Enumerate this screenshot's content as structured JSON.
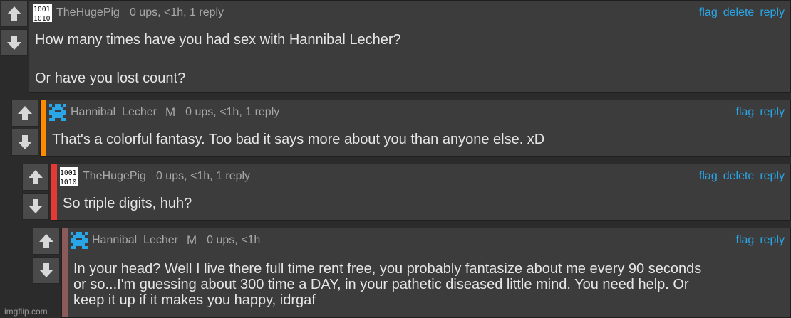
{
  "comments": [
    {
      "username": "TheHugePig",
      "gender": "",
      "meta": "0 ups, <1h, 1 reply",
      "actions": [
        "flag",
        "delete",
        "reply"
      ],
      "text": [
        "How many times have you had sex with Hannibal Lecher?",
        "",
        "Or have you lost count?"
      ],
      "stripe_color": "",
      "avatar": "binary-avatar-icon"
    },
    {
      "username": "Hannibal_Lecher",
      "gender": "M",
      "meta": "0 ups, <1h, 1 reply",
      "actions": [
        "flag",
        "reply"
      ],
      "text": [
        "That's a colorful fantasy. Too bad it says more about you than anyone else. xD"
      ],
      "stripe_color": "#ff8c00",
      "avatar": "pixel-avatar-icon"
    },
    {
      "username": "TheHugePig",
      "gender": "",
      "meta": "0 ups, <1h, 1 reply",
      "actions": [
        "flag",
        "delete",
        "reply"
      ],
      "text": [
        "So triple digits, huh?"
      ],
      "stripe_color": "#e53935",
      "avatar": "binary-avatar-icon"
    },
    {
      "username": "Hannibal_Lecher",
      "gender": "M",
      "meta": "0 ups, <1h",
      "actions": [
        "flag",
        "reply"
      ],
      "text": [
        "In your head? Well I live there full time rent free, you probably fantasize about me every 90 seconds",
        "or so...I'm guessing about 300 time a DAY, in your pathetic diseased little mind. You need help. Or",
        "keep it up if it makes you happy, idrgaf"
      ],
      "stripe_color": "#8b5a5a",
      "avatar": "pixel-avatar-icon"
    }
  ],
  "watermark": "imgflip.com",
  "colors": {
    "link": "#29a6e8",
    "panel": "#3c3c3c",
    "background": "#2b2b2b"
  }
}
